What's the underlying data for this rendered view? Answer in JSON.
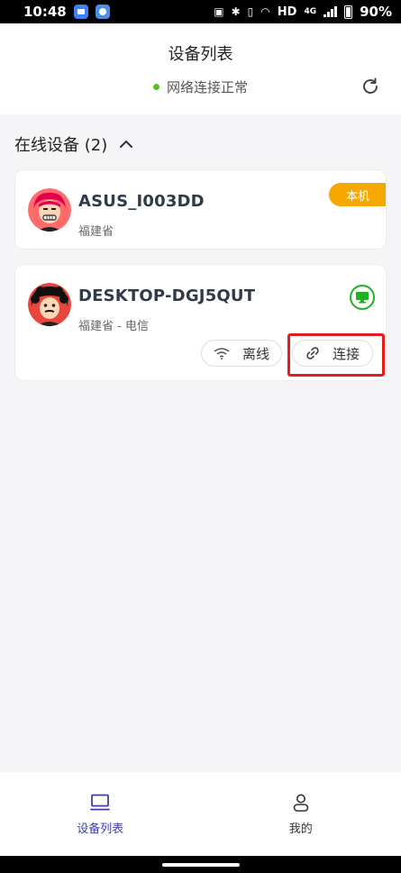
{
  "status_bar": {
    "time": "10:48",
    "network": "HD",
    "network_type": "4G",
    "battery": "90%"
  },
  "header": {
    "title": "设备列表",
    "network_status": "网络连接正常",
    "refresh_icon": "refresh-icon"
  },
  "section": {
    "title": "在线设备 (2)"
  },
  "devices": [
    {
      "name": "ASUS_I003DD",
      "location": "福建省",
      "badge": "本机"
    },
    {
      "name": "DESKTOP-DGJ5QUT",
      "location": "福建省 - 电信",
      "offline_label": "离线",
      "connect_label": "连接"
    }
  ],
  "bottom_nav": {
    "items": [
      {
        "label": "设备列表",
        "icon": "monitor-icon",
        "active": true
      },
      {
        "label": "我的",
        "icon": "user-icon",
        "active": false
      }
    ]
  },
  "colors": {
    "accent": "#3c3fa8",
    "badge": "#f7a800",
    "online": "#52c41a",
    "highlight": "#e11d1d"
  }
}
